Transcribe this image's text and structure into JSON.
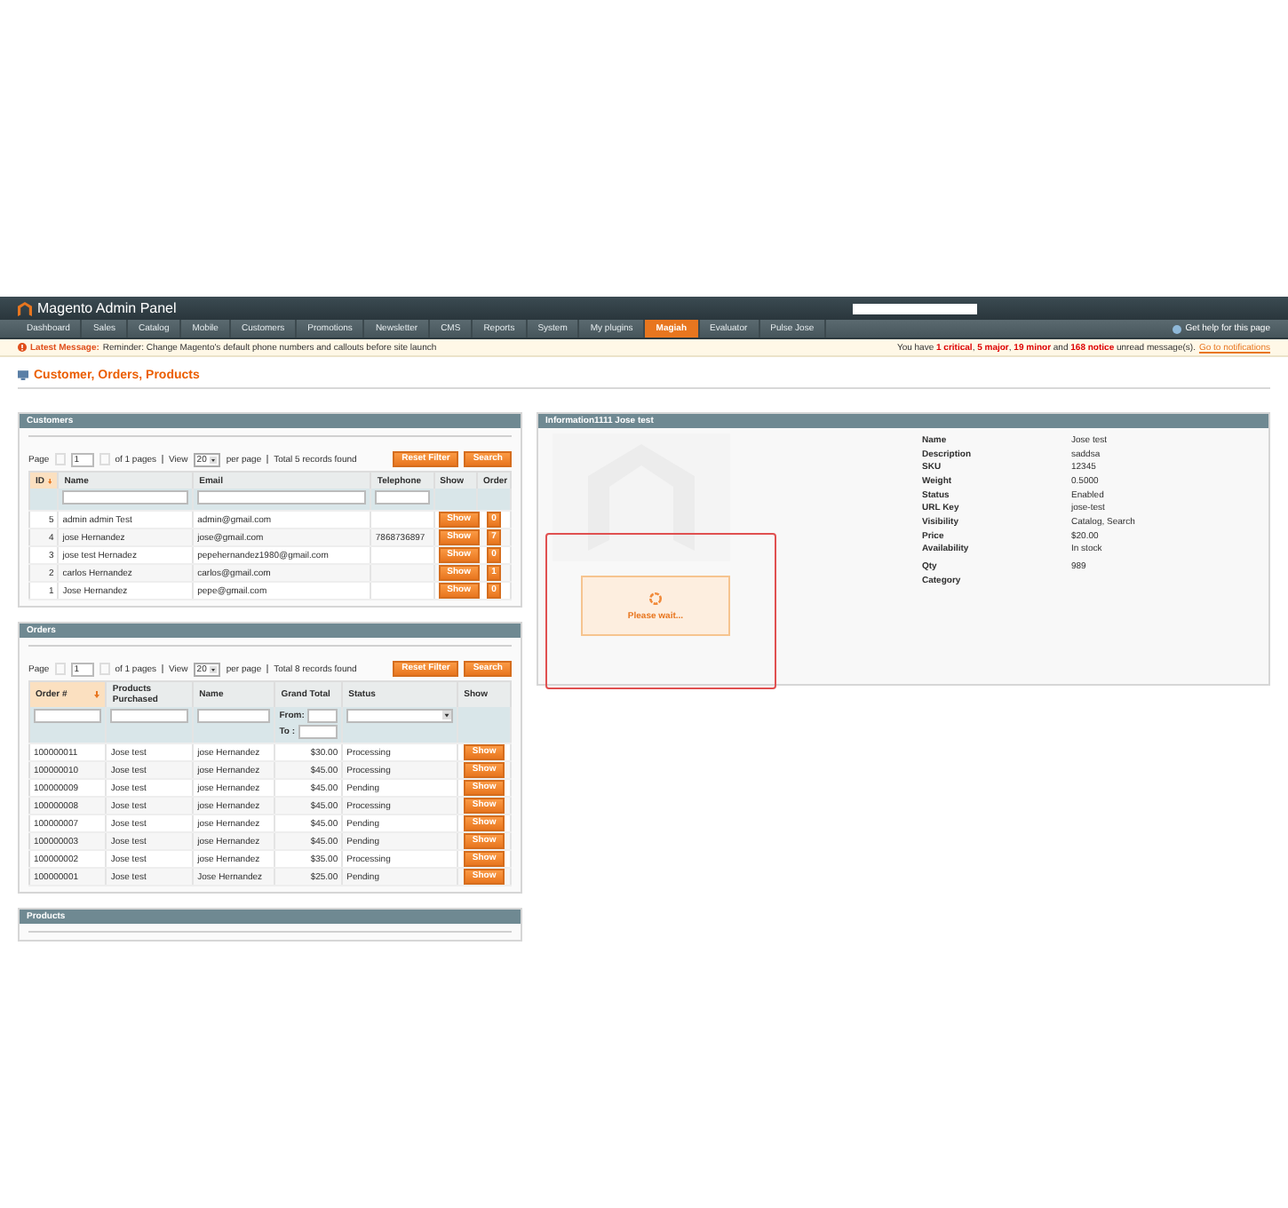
{
  "header": {
    "logo_text": "Magento Admin Panel"
  },
  "nav": [
    {
      "label": "Dashboard",
      "selected": false
    },
    {
      "label": "Sales",
      "selected": false
    },
    {
      "label": "Catalog",
      "selected": false
    },
    {
      "label": "Mobile",
      "selected": false
    },
    {
      "label": "Customers",
      "selected": false
    },
    {
      "label": "Promotions",
      "selected": false
    },
    {
      "label": "Newsletter",
      "selected": false
    },
    {
      "label": "CMS",
      "selected": false
    },
    {
      "label": "Reports",
      "selected": false
    },
    {
      "label": "System",
      "selected": false
    },
    {
      "label": "My plugins",
      "selected": false
    },
    {
      "label": "Magiah",
      "selected": true
    },
    {
      "label": "Evaluator",
      "selected": false
    },
    {
      "label": "Pulse Jose",
      "selected": false
    }
  ],
  "help_link": "Get help for this page",
  "message": {
    "label": "Latest Message:",
    "text": "Reminder: Change Magento's default phone numbers and callouts before site launch",
    "summary": "You have **1 critical**, **5 major**, **19 minor** and **168 notice** unread message(s).",
    "link": "Go to notifications"
  },
  "page_title": "Customer, Orders, Products",
  "customers": {
    "title": "Customers",
    "pager": {
      "page_label": "Page",
      "page": "1",
      "of_pages": "of 1 pages",
      "view_label": "View",
      "view": "20",
      "per_page": "per page",
      "total": "Total 5 records found"
    },
    "buttons": [
      "Reset Filter",
      "Search"
    ],
    "columns": [
      {
        "label": "ID",
        "sorted": true,
        "kind": "none"
      },
      {
        "label": "Name",
        "sorted": false,
        "kind": "text"
      },
      {
        "label": "Email",
        "sorted": false,
        "kind": "text"
      },
      {
        "label": "Telephone",
        "sorted": false,
        "kind": "text"
      },
      {
        "label": "Show",
        "sorted": false,
        "kind": "none"
      },
      {
        "label": "Order",
        "sorted": false,
        "kind": "none"
      }
    ],
    "rows": [
      {
        "id": "5",
        "name": "admin admin Test",
        "email": "admin@gmail.com",
        "show": "Show",
        "order": "0"
      },
      {
        "id": "4",
        "name": "jose Hernandez",
        "email": "jose@gmail.com",
        "telephone": "7868736897",
        "show": "Show",
        "order": "7"
      },
      {
        "id": "3",
        "name": "jose test Hernadez",
        "email": "pepehernandez1980@gmail.com",
        "show": "Show",
        "order": "0"
      },
      {
        "id": "2",
        "name": "carlos Hernandez",
        "email": "carlos@gmail.com",
        "show": "Show",
        "order": "1"
      },
      {
        "id": "1",
        "name": "Jose Hernandez",
        "email": "pepe@gmail.com",
        "show": "Show",
        "order": "0"
      }
    ]
  },
  "orders": {
    "title": "Orders",
    "pager": {
      "page_label": "Page",
      "page": "1",
      "of_pages": "of 1 pages",
      "view_label": "View",
      "view": "20",
      "per_page": "per page",
      "total": "Total 8 records found"
    },
    "buttons": [
      "Reset Filter",
      "Search"
    ],
    "columns": [
      {
        "label": "Order #",
        "sorted": true,
        "kind": "text"
      },
      {
        "label": "Products Purchased",
        "sorted": false,
        "kind": "text"
      },
      {
        "label": "Name",
        "sorted": false,
        "kind": "text"
      },
      {
        "label": "Grand Total",
        "sorted": false,
        "kind": "range"
      },
      {
        "label": "Status",
        "sorted": false,
        "kind": "select"
      },
      {
        "label": "Show",
        "sorted": false,
        "kind": "none"
      }
    ],
    "range_labels": [
      "From:",
      "To :"
    ],
    "rows": [
      {
        "order": "100000011",
        "product": "Jose test",
        "name": "jose Hernandez",
        "total": "$30.00",
        "status": "Processing",
        "show": "Show"
      },
      {
        "order": "100000010",
        "product": "Jose test",
        "name": "jose Hernandez",
        "total": "$45.00",
        "status": "Processing",
        "show": "Show"
      },
      {
        "order": "100000009",
        "product": "Jose test",
        "name": "jose Hernandez",
        "total": "$45.00",
        "status": "Pending",
        "show": "Show"
      },
      {
        "order": "100000008",
        "product": "Jose test",
        "name": "jose Hernandez",
        "total": "$45.00",
        "status": "Processing",
        "show": "Show"
      },
      {
        "order": "100000007",
        "product": "Jose test",
        "name": "jose Hernandez",
        "total": "$45.00",
        "status": "Pending",
        "show": "Show"
      },
      {
        "order": "100000003",
        "product": "Jose test",
        "name": "jose Hernandez",
        "total": "$45.00",
        "status": "Pending",
        "show": "Show"
      },
      {
        "order": "100000002",
        "product": "Jose test",
        "name": "jose Hernandez",
        "total": "$35.00",
        "status": "Processing",
        "show": "Show"
      },
      {
        "order": "100000001",
        "product": "Jose test",
        "name": "Jose Hernandez",
        "total": "$25.00",
        "status": "Pending",
        "show": "Show"
      }
    ]
  },
  "products": {
    "title": "Products"
  },
  "info": {
    "title": "Information1111 Jose test",
    "fields": [
      {
        "label": "Name",
        "value": "Jose test"
      },
      {
        "label": "Description",
        "value": "saddsa"
      },
      {
        "label": "SKU",
        "value": "12345"
      },
      {
        "label": "Weight",
        "value": "0.5000"
      },
      {
        "label": "Status",
        "value": "Enabled"
      },
      {
        "label": "URL Key",
        "value": "jose-test"
      },
      {
        "label": "Visibility",
        "value": "Catalog, Search"
      },
      {
        "label": "Price",
        "value": "$20.00"
      },
      {
        "label": "Availability",
        "value": "In stock"
      },
      {
        "label": "Qty",
        "value": "989"
      },
      {
        "label": "Category"
      }
    ],
    "loading": {
      "text": "Please wait..."
    }
  }
}
